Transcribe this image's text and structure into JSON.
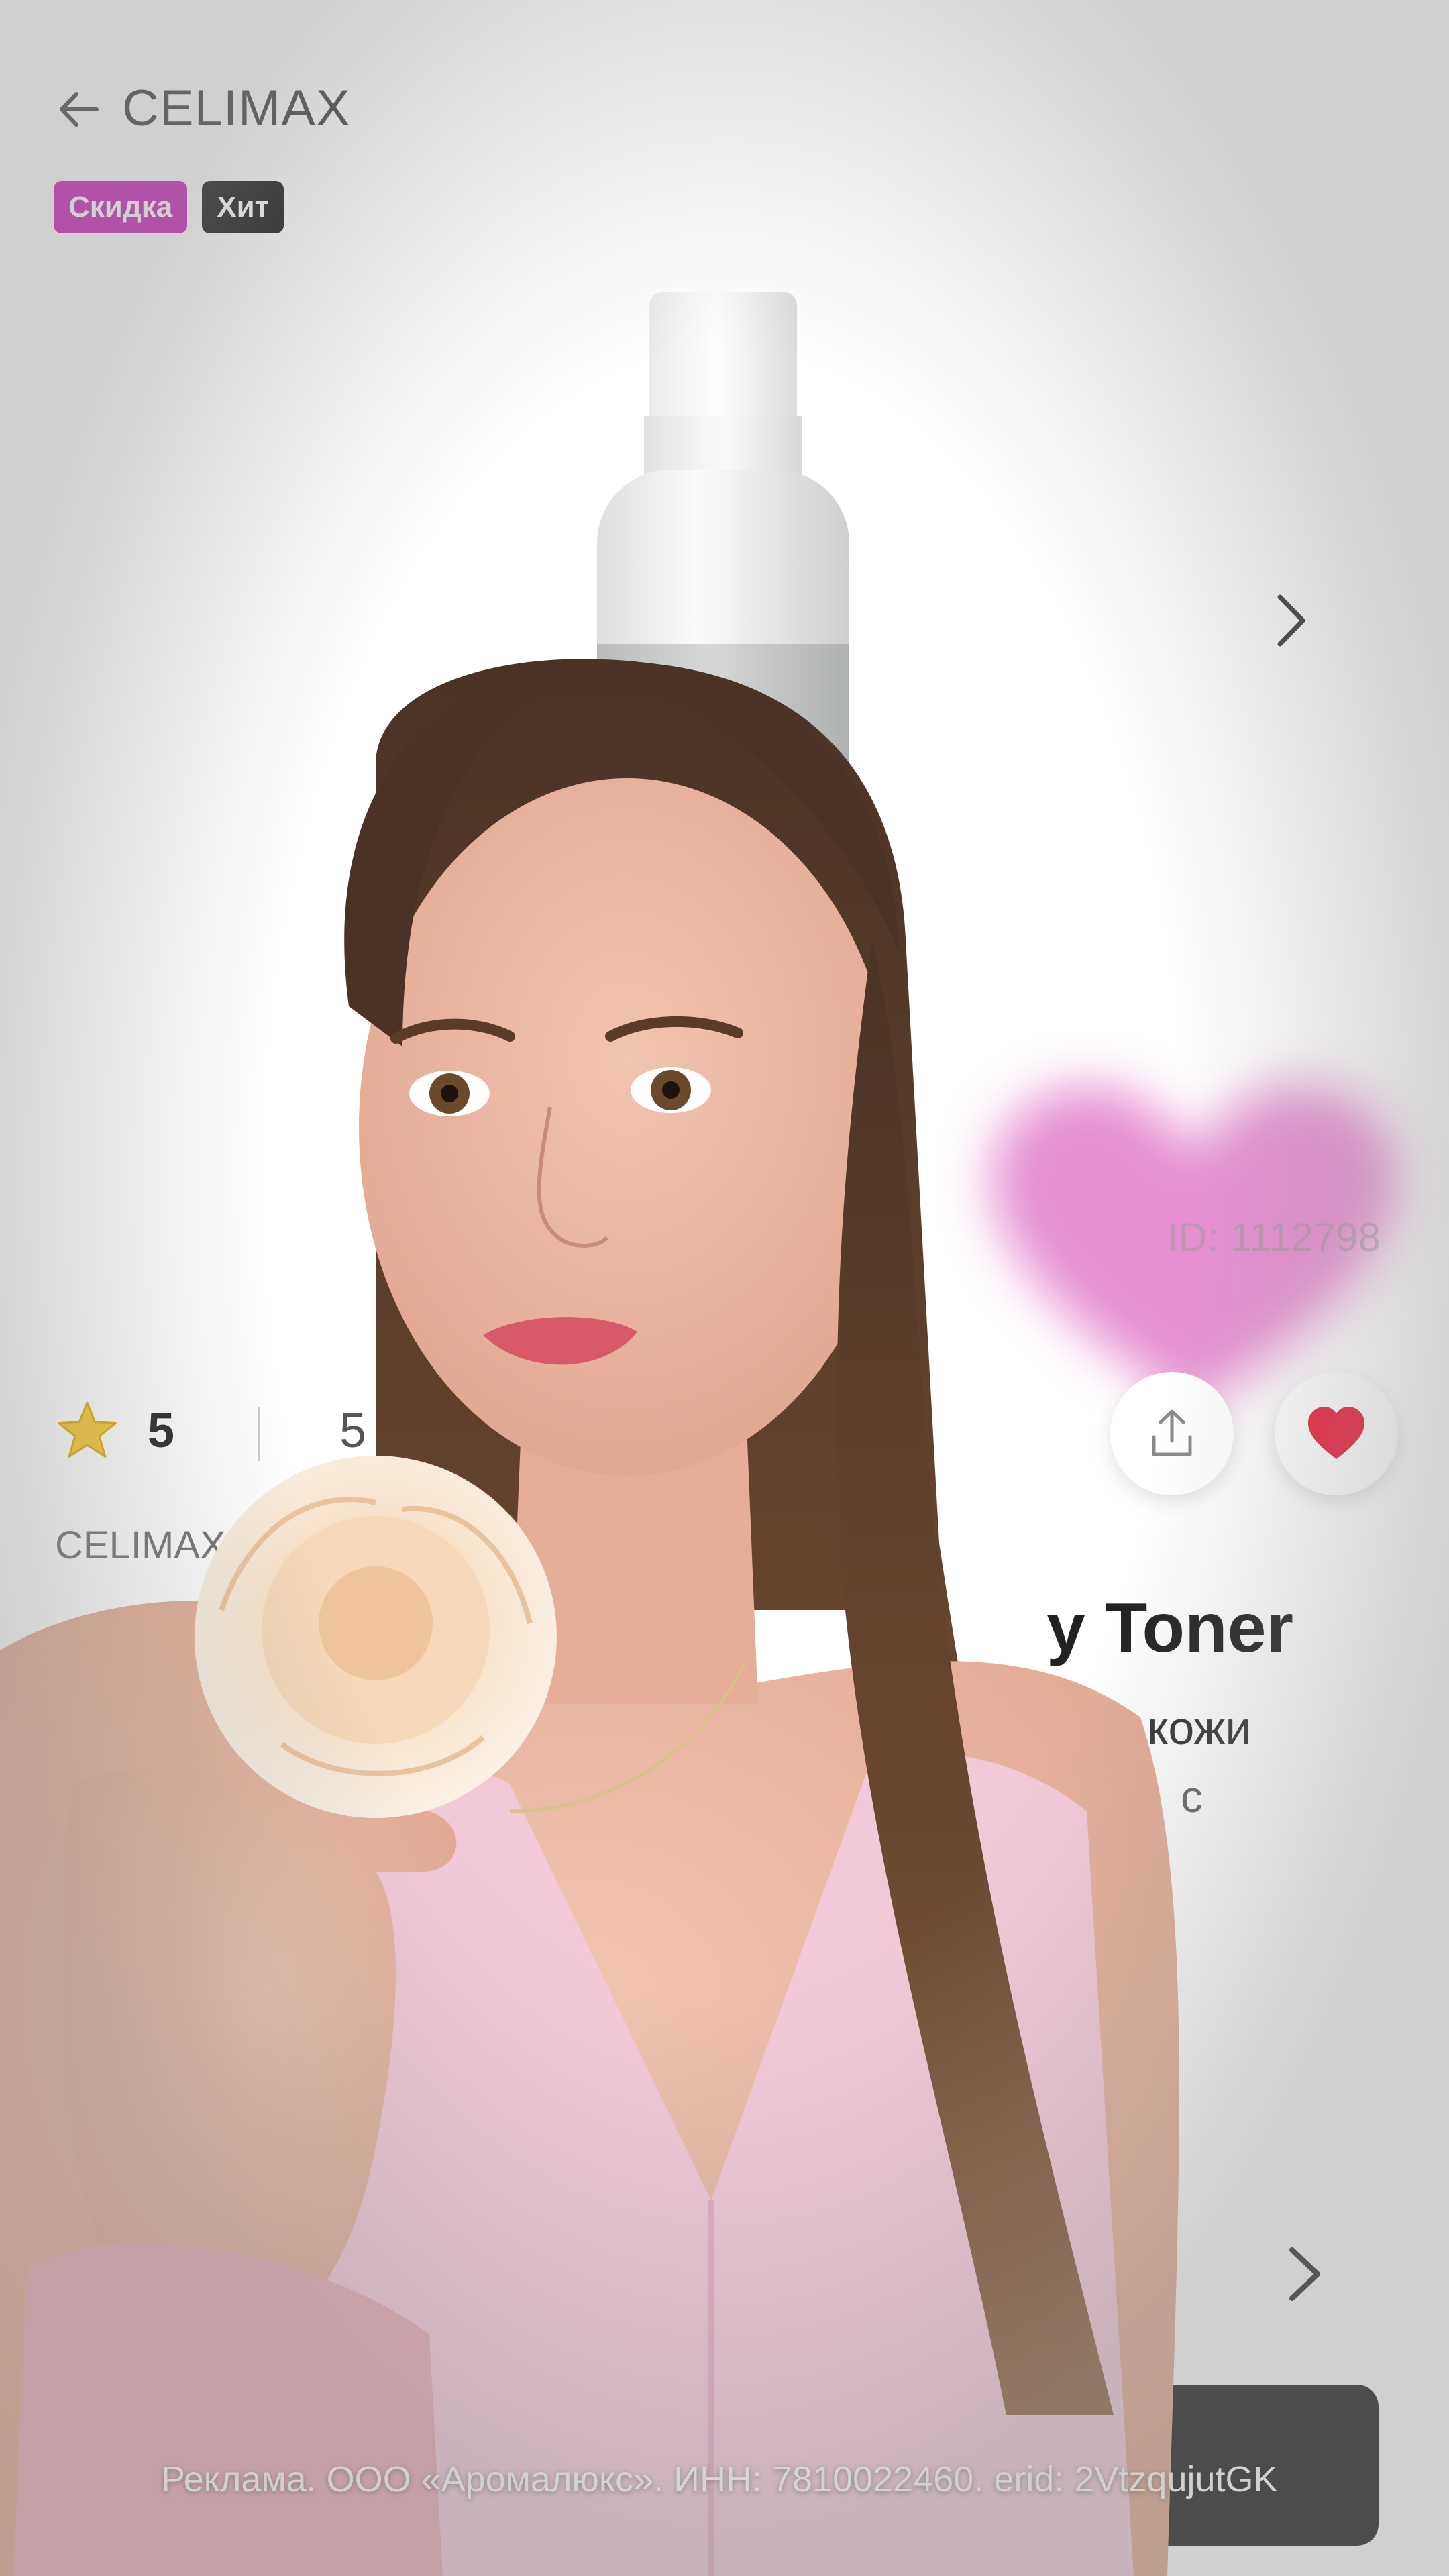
{
  "header": {
    "back_icon": "arrow-left-icon",
    "title": "CELIMAX"
  },
  "badges": {
    "sale": "Скидка",
    "hit": "Хит"
  },
  "gallery": {
    "next_icon": "chevron-right-icon"
  },
  "product": {
    "id_label": "ID: 1112798",
    "name_visible": "y Toner",
    "desc_line1_visible": "кожи",
    "desc_line2_visible": "с"
  },
  "actions": {
    "share_icon": "share-icon",
    "favorite_icon": "heart-icon",
    "favorite_color": "#e8223f"
  },
  "rating": {
    "star_icon": "star-icon",
    "star_color": "#f6c630",
    "value": "5",
    "reviews": "5 отз"
  },
  "brand_small": "CELIMAX",
  "section": {
    "arrow_icon": "chevron-right-icon"
  },
  "ad_disclaimer": "Реклама. ООО «Аромалюкс». ИНН: 7810022460. erid: 2VtzqujutGK",
  "colors": {
    "accent_sale": "#c71bb4",
    "badge_hit": "#111111",
    "heart_blur": "#e27cc8"
  }
}
